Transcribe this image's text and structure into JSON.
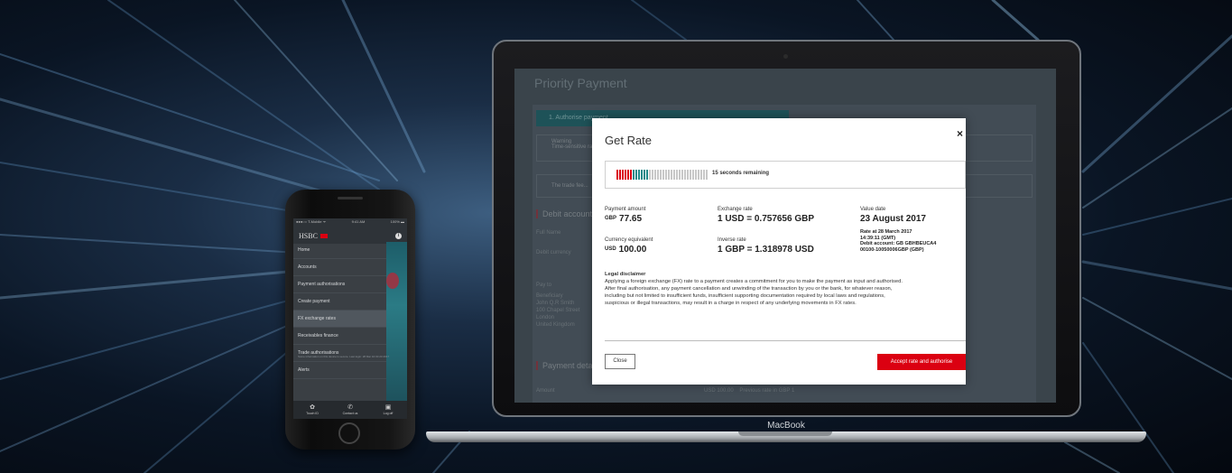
{
  "phone": {
    "status_left": "●●●○○ T-Mobile ᯤ",
    "status_time": "9:41 AM",
    "status_right": "100% ▬",
    "brand": "HSBC",
    "menu": [
      {
        "label": "Home"
      },
      {
        "label": "Accounts"
      },
      {
        "label": "Payment authorisations"
      },
      {
        "label": "Create payment"
      },
      {
        "label": "FX exchange rates"
      },
      {
        "label": "Receivables finance"
      },
      {
        "label": "Trade authorisations"
      },
      {
        "label": "Alerts"
      }
    ],
    "footer_text": "Some information on this device is secure. Last login: 28 Mar 10:30 23 2017",
    "tabs": [
      {
        "label": "Touch ID",
        "icon": "fingerprint-icon"
      },
      {
        "label": "Contact us",
        "icon": "phone-icon"
      },
      {
        "label": "Log off",
        "icon": "lock-icon"
      }
    ]
  },
  "laptop": {
    "brand": "MacBook",
    "page_title": "Priority Payment",
    "step_label": "1. Authorise payment",
    "warning_title": "Warning",
    "warning_text": "Time-sensitive rate...",
    "info_text": "The trade fee...",
    "section_debit": "Debit account",
    "label_full_name": "Full Name",
    "label_debit_currency": "Debit currency",
    "label_pay_to": "Pay to",
    "beneficiary_lines": [
      "Beneficiary",
      "John Q.R Smith",
      "100 Chapel Street",
      "London",
      "United Kingdom"
    ],
    "section_payment": "Payment details",
    "amount_label": "Amount",
    "amount_value": "USD 100.00",
    "previous_rate": "Previous rate in GBP 1"
  },
  "modal": {
    "title": "Get Rate",
    "close_glyph": "×",
    "timer_text": "15 seconds remaining",
    "timer_fraction_remaining": 0.35,
    "payment_amount_label": "Payment amount",
    "payment_amount_currency": "GBP",
    "payment_amount_value": "77.65",
    "exchange_rate_label": "Exchange rate",
    "exchange_rate_value": "1 USD = 0.757656 GBP",
    "value_date_label": "Value date",
    "value_date_value": "23 August 2017",
    "currency_equiv_label": "Currency equivalent",
    "currency_equiv_currency": "USD",
    "currency_equiv_value": "100.00",
    "inverse_rate_label": "Inverse rate",
    "inverse_rate_value": "1 GBP = 1.318978 USD",
    "rate_at_line1": "Rate at 28 March 2017",
    "rate_at_line2": "14:39:11 (GMT)",
    "debit_account_line1": "Debit account: GB GBHBEUCA4",
    "debit_account_line2": "00100-10050006GBP (GBP)",
    "disclaimer_title": "Legal disclaimer",
    "disclaimer_lines": [
      "Applying a foreign exchange (FX) rate to a payment creates a commitment for you to make the payment as input and authorised.",
      "After final authorisation, any payment cancellation and unwinding of the transaction by you or the bank, for whatever reason,",
      "including but not limited to insufficient funds, insufficient supporting documentation required by local laws and regulations,",
      "suspicious or illegal transactions, may result in a charge in respect of any underlying movements in FX rates."
    ],
    "close_button": "Close",
    "accept_button": "Accept rate and authorise"
  },
  "colors": {
    "accent_red": "#db0011",
    "teal": "#1f8a8a",
    "bar_grey": "#c8c8c8"
  }
}
